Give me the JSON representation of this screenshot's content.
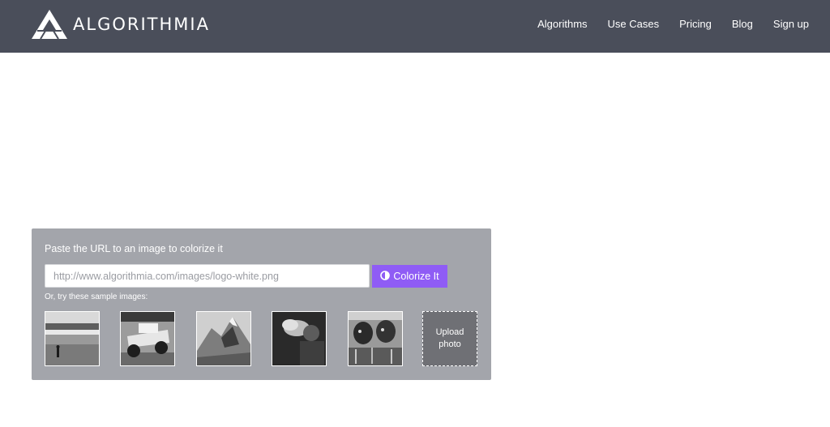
{
  "brand": {
    "name": "ALGORITHMIA"
  },
  "nav": {
    "items": [
      {
        "label": "Algorithms"
      },
      {
        "label": "Use Cases"
      },
      {
        "label": "Pricing"
      },
      {
        "label": "Blog"
      },
      {
        "label": "Sign up"
      }
    ]
  },
  "colorizer": {
    "title": "Paste the URL to an image to colorize it",
    "url_placeholder": "http://www.algorithmia.com/images/logo-white.png",
    "button_label": "Colorize It",
    "button_icon": "half-circle-contrast-icon",
    "samples_label": "Or, try these sample images:",
    "samples": [
      {
        "subject": "beach"
      },
      {
        "subject": "race-car"
      },
      {
        "subject": "mountain"
      },
      {
        "subject": "smoker"
      },
      {
        "subject": "cows"
      }
    ],
    "upload_label_line1": "Upload",
    "upload_label_line2": "photo"
  },
  "colors": {
    "header_bg": "#4a4e5a",
    "panel_bg": "#a3a5ab",
    "accent": "#8f5cf5",
    "upload_bg": "#6f7075"
  }
}
